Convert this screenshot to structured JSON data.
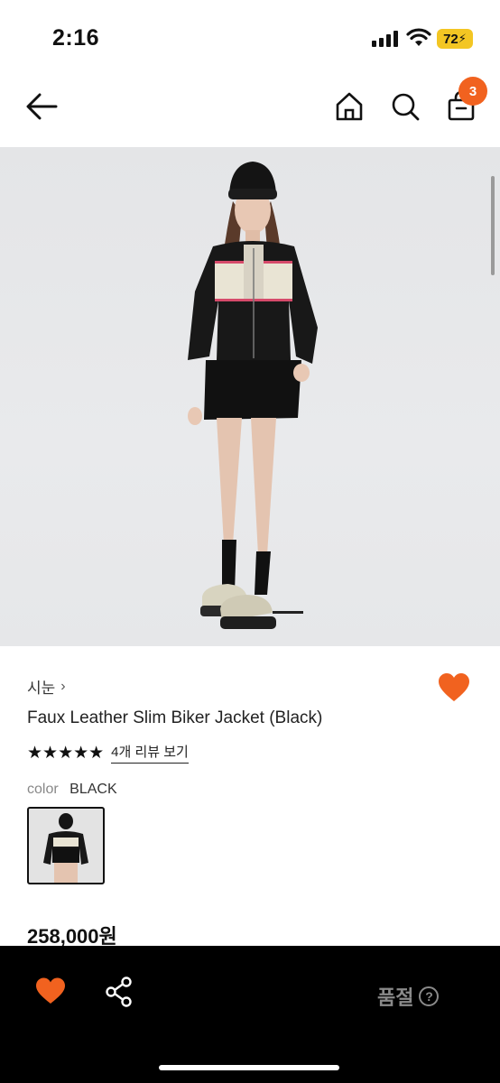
{
  "status": {
    "time": "2:16",
    "battery": "72"
  },
  "nav": {
    "cart_count": "3"
  },
  "product": {
    "brand": "시눈",
    "title": "Faux Leather Slim Biker Jacket (Black)",
    "rating_stars": "★★★★★",
    "review_link": "4개 리뷰 보기",
    "color_label": "color",
    "color_value": "BLACK",
    "price": "258,000원"
  },
  "bottom": {
    "soldout_label": "품절"
  },
  "colors": {
    "accent": "#f1621f",
    "bottom_bar": "#000000"
  },
  "icons": [
    "arrow-left-icon",
    "home-icon",
    "search-icon",
    "shopping-bag-icon",
    "heart-icon",
    "share-icon",
    "question-circle-icon"
  ]
}
